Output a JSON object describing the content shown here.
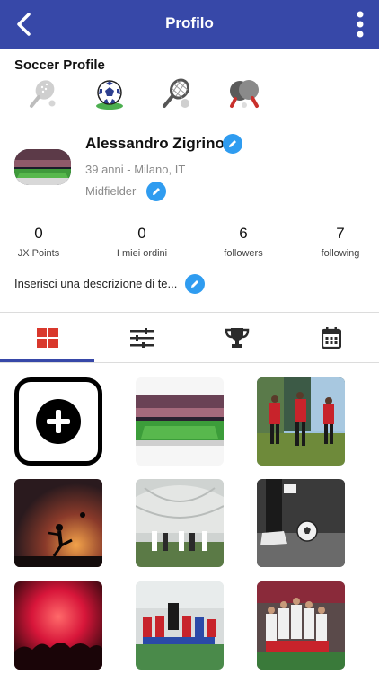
{
  "header": {
    "title": "Profilo",
    "back_icon": "chevron-left-icon",
    "more_icon": "more-vertical-icon"
  },
  "soccer_profile": {
    "title": "Soccer Profile",
    "sports": [
      "padel-icon",
      "soccer-ball-icon",
      "tennis-icon",
      "ping-pong-icon"
    ],
    "selected_sport": "soccer-ball-icon"
  },
  "profile": {
    "name": "Alessandro Zigrino",
    "age_location": "39 anni - Milano, IT",
    "role": "Midfielder",
    "description": "Inserisci una descrizione di te..."
  },
  "stats": [
    {
      "value": "0",
      "label": "JX Points"
    },
    {
      "value": "0",
      "label": "I miei ordini"
    },
    {
      "value": "6",
      "label": "followers"
    },
    {
      "value": "7",
      "label": "following"
    }
  ],
  "tabs": [
    {
      "icon": "grid-icon",
      "active": true
    },
    {
      "icon": "sliders-icon",
      "active": false
    },
    {
      "icon": "trophy-icon",
      "active": false
    },
    {
      "icon": "calendar-icon",
      "active": false
    }
  ],
  "colors": {
    "header": "#3748a8",
    "edit_accent": "#2f9cf0",
    "active_tab": "#d9382c",
    "tab_icon": "#2b2b2b"
  },
  "gallery": [
    "add-photo",
    "stadium-night",
    "players-red-kit-forest",
    "sunset-kick-silhouette",
    "dome-indoor-match",
    "boots-and-ball",
    "red-flares-crowd",
    "team-huddle-striped",
    "team-celebration"
  ]
}
